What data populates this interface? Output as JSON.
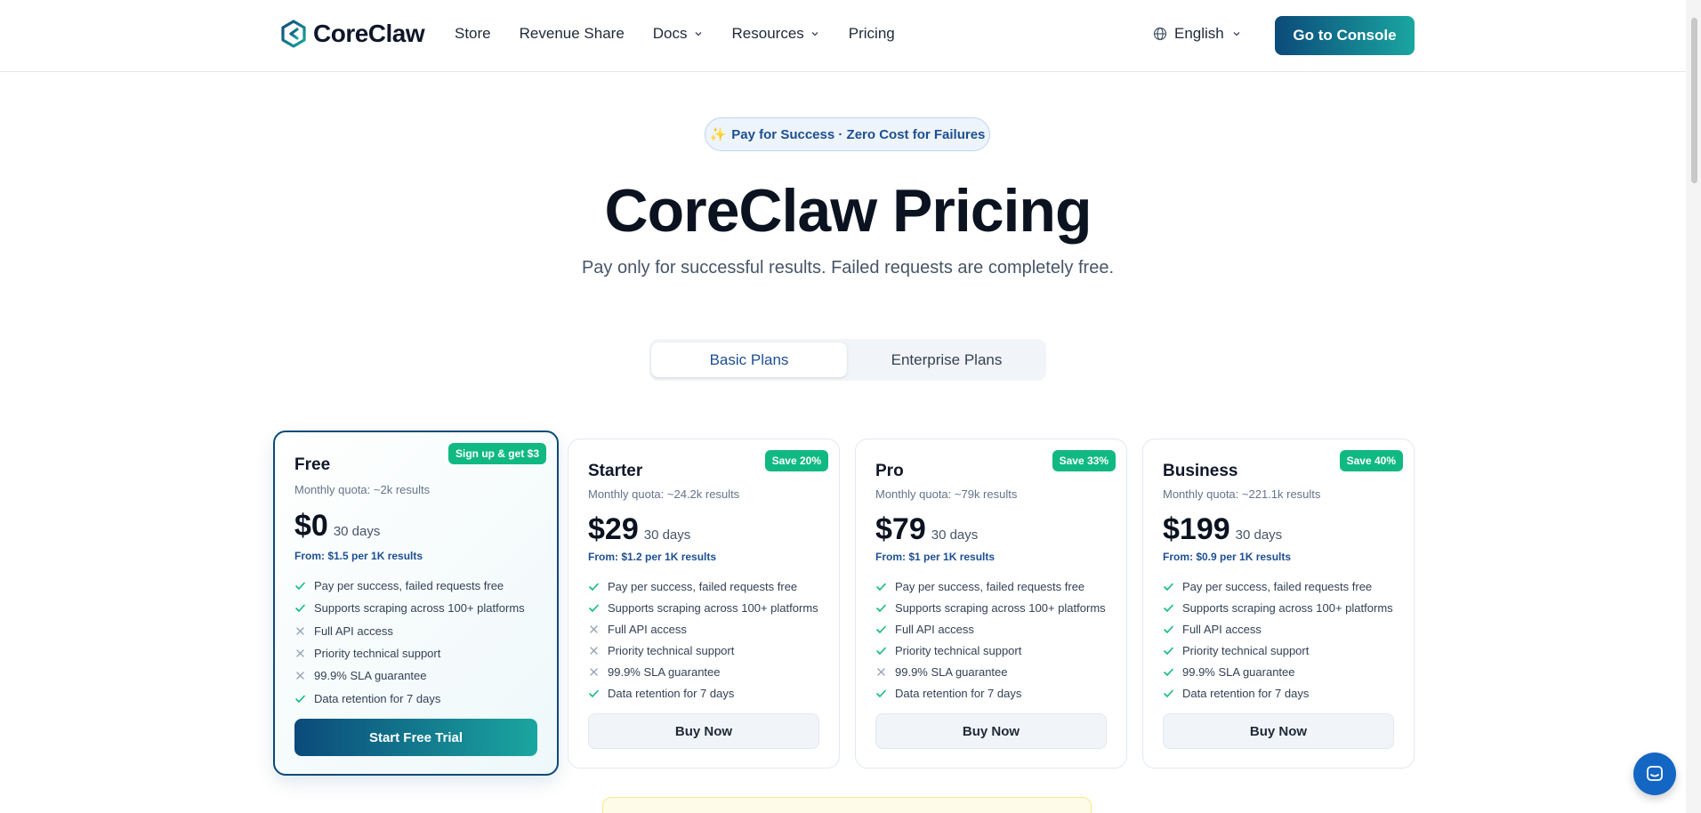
{
  "nav": {
    "brand": "CoreClaw",
    "links": [
      {
        "label": "Store",
        "dropdown": false
      },
      {
        "label": "Revenue Share",
        "dropdown": false
      },
      {
        "label": "Docs",
        "dropdown": true
      },
      {
        "label": "Resources",
        "dropdown": true
      },
      {
        "label": "Pricing",
        "dropdown": false
      }
    ],
    "language": "English",
    "console_button": "Go to Console"
  },
  "hero": {
    "badge": "Pay for Success · Zero Cost for Failures",
    "title": "CoreClaw Pricing",
    "subtitle": "Pay only for successful results. Failed requests are completely free."
  },
  "plan_toggle": {
    "options": [
      "Basic Plans",
      "Enterprise Plans"
    ],
    "selected": "Basic Plans"
  },
  "plans": [
    {
      "name": "Free",
      "badge": "Sign up & get $3",
      "quota": "Monthly quota: ~2k results",
      "price": "$0",
      "period": "30 days",
      "from": "From: $1.5 per 1K results",
      "features": [
        {
          "text": "Pay per success, failed requests free",
          "included": true
        },
        {
          "text": "Supports scraping across 100+ platforms",
          "included": true
        },
        {
          "text": "Full API access",
          "included": false
        },
        {
          "text": "Priority technical support",
          "included": false
        },
        {
          "text": "99.9% SLA guarantee",
          "included": false
        },
        {
          "text": "Data retention for 7 days",
          "included": true
        }
      ],
      "button": "Start Free Trial",
      "featured": true
    },
    {
      "name": "Starter",
      "badge": "Save 20%",
      "quota": "Monthly quota: ~24.2k results",
      "price": "$29",
      "period": "30 days",
      "from": "From: $1.2 per 1K results",
      "features": [
        {
          "text": "Pay per success, failed requests free",
          "included": true
        },
        {
          "text": "Supports scraping across 100+ platforms",
          "included": true
        },
        {
          "text": "Full API access",
          "included": false
        },
        {
          "text": "Priority technical support",
          "included": false
        },
        {
          "text": "99.9% SLA guarantee",
          "included": false
        },
        {
          "text": "Data retention for 7 days",
          "included": true
        }
      ],
      "button": "Buy Now",
      "featured": false
    },
    {
      "name": "Pro",
      "badge": "Save 33%",
      "quota": "Monthly quota: ~79k results",
      "price": "$79",
      "period": "30 days",
      "from": "From: $1 per 1K results",
      "features": [
        {
          "text": "Pay per success, failed requests free",
          "included": true
        },
        {
          "text": "Supports scraping across 100+ platforms",
          "included": true
        },
        {
          "text": "Full API access",
          "included": true
        },
        {
          "text": "Priority technical support",
          "included": true
        },
        {
          "text": "99.9% SLA guarantee",
          "included": false
        },
        {
          "text": "Data retention for 7 days",
          "included": true
        }
      ],
      "button": "Buy Now",
      "featured": false
    },
    {
      "name": "Business",
      "badge": "Save 40%",
      "quota": "Monthly quota: ~221.1k results",
      "price": "$199",
      "period": "30 days",
      "from": "From: $0.9 per 1K results",
      "features": [
        {
          "text": "Pay per success, failed requests free",
          "included": true
        },
        {
          "text": "Supports scraping across 100+ platforms",
          "included": true
        },
        {
          "text": "Full API access",
          "included": true
        },
        {
          "text": "Priority technical support",
          "included": true
        },
        {
          "text": "99.9% SLA guarantee",
          "included": true
        },
        {
          "text": "Data retention for 7 days",
          "included": true
        }
      ],
      "button": "Buy Now",
      "featured": false
    }
  ],
  "colors": {
    "brand_dark": "#0b4a7a",
    "brand_teal": "#1aa6a0",
    "save_badge": "#10b981",
    "check": "#10b981",
    "cross": "#94a3b8",
    "chat_button": "#1466c4"
  },
  "icons": {
    "logo": "coreclaw-logo-icon",
    "language": "globe-icon",
    "dropdown": "chevron-down-icon",
    "included": "check-icon",
    "excluded": "x-icon",
    "chat": "chat-icon"
  }
}
